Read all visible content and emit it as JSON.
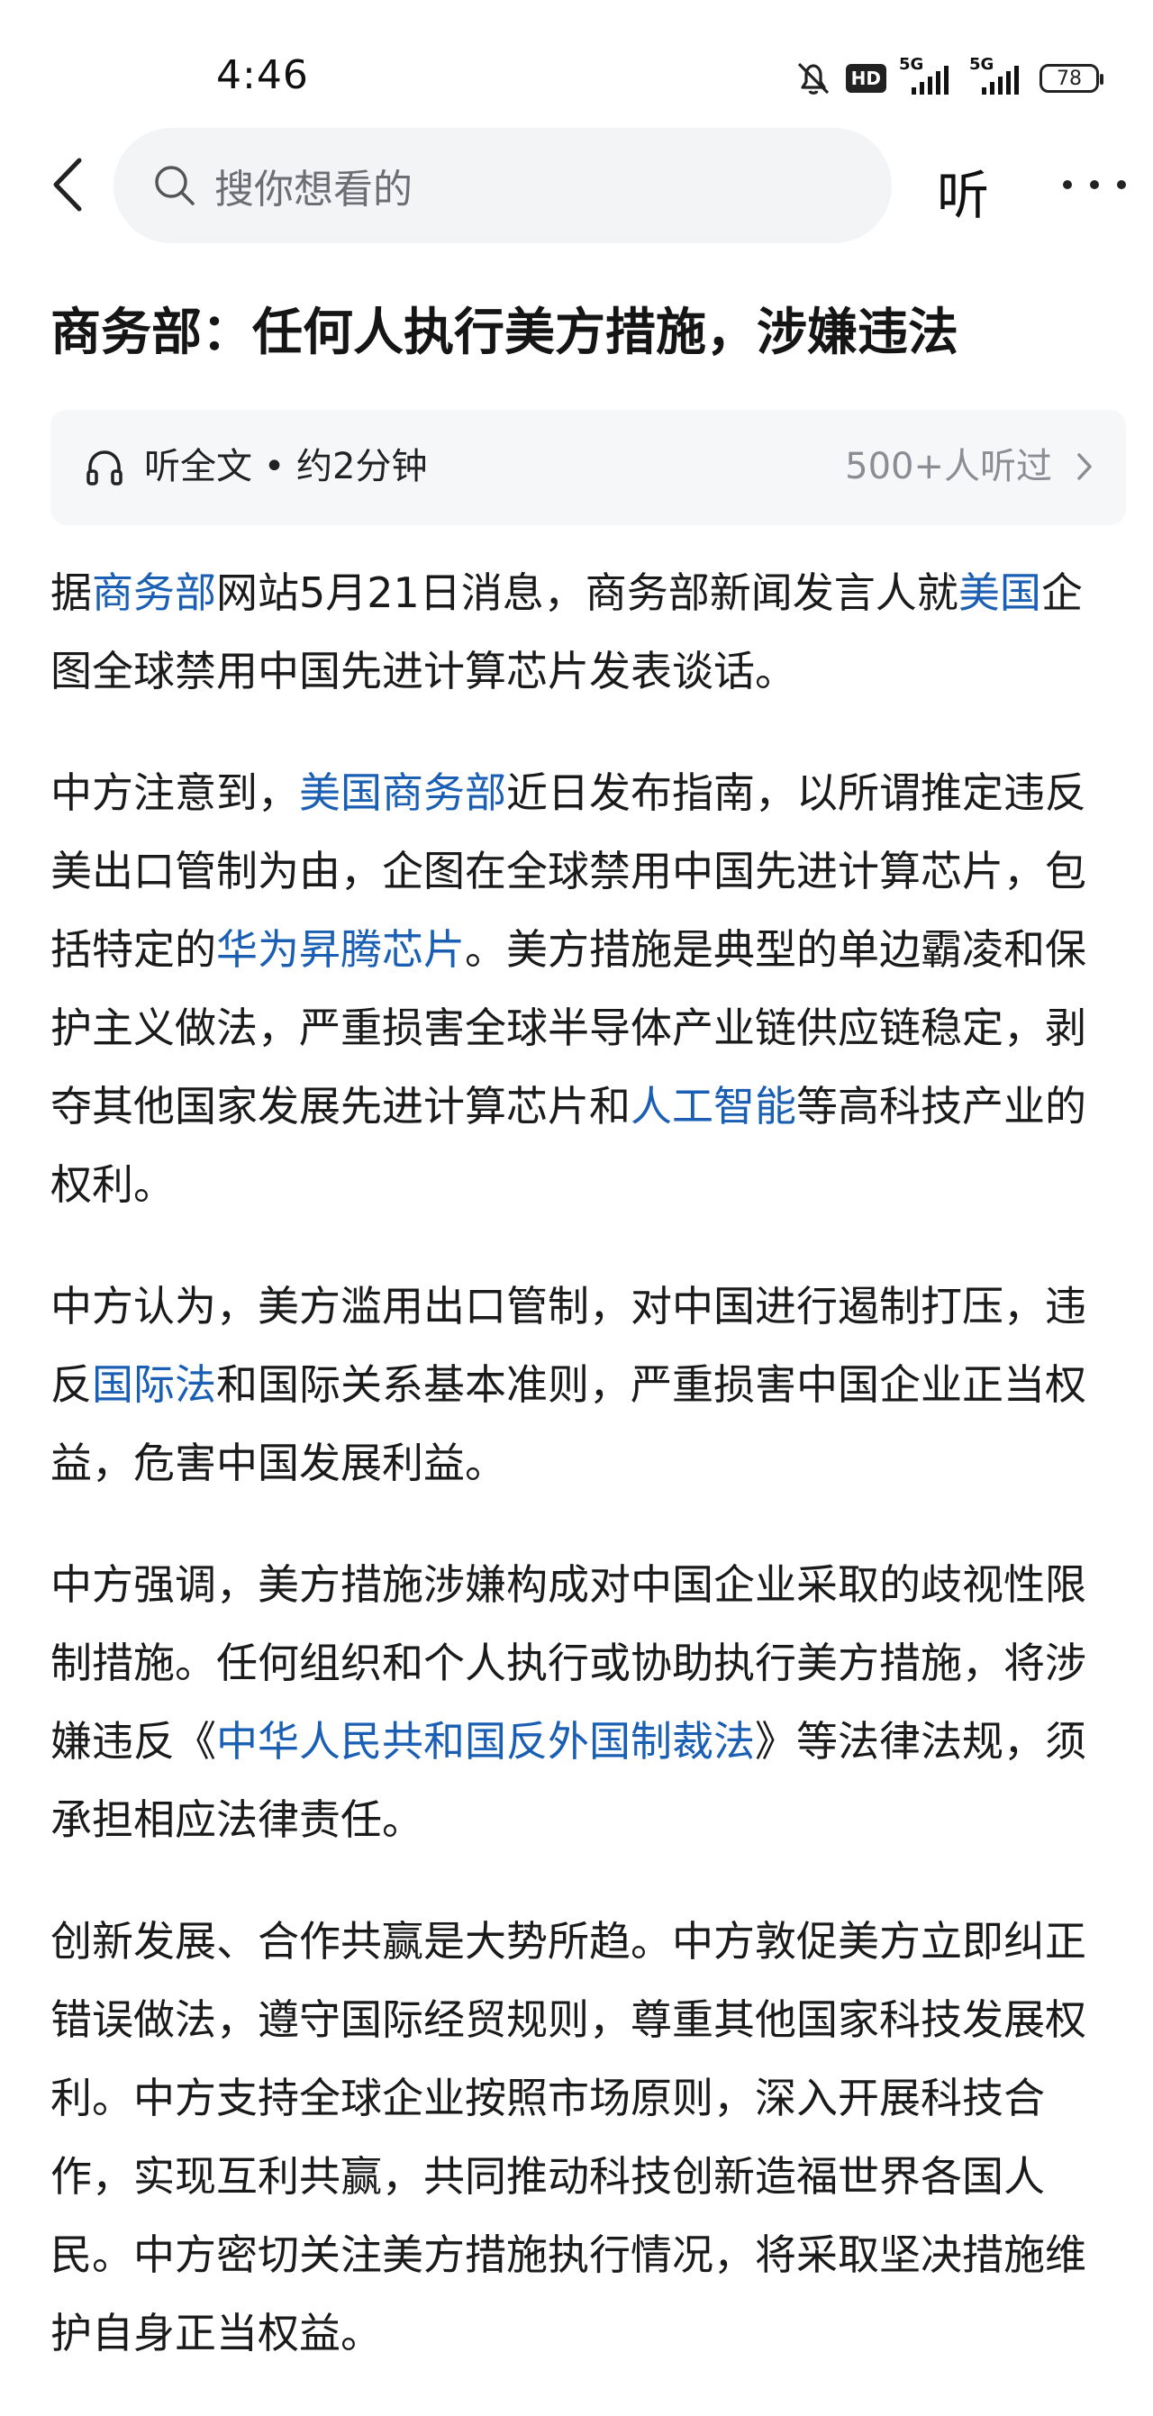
{
  "status_bar": {
    "time": "4:46",
    "hd_label": "HD",
    "sim1_label": "5G",
    "sim2_label": "5G",
    "battery": "78"
  },
  "header": {
    "search_placeholder": "搜你想看的",
    "listen_label": "听"
  },
  "article": {
    "title": "商务部：任何人执行美方措施，涉嫌违法",
    "audio": {
      "label": "听全文 • 约2分钟",
      "count": "500+人听过"
    },
    "paragraphs": [
      [
        {
          "text": "据"
        },
        {
          "text": "商务部",
          "link": true
        },
        {
          "text": "网站5月21日消息，商务部新闻发言人就"
        },
        {
          "text": "美国",
          "link": true
        },
        {
          "text": "企图全球禁用中国先进计算芯片发表谈话。"
        }
      ],
      [
        {
          "text": "中方注意到，"
        },
        {
          "text": "美国商务部",
          "link": true
        },
        {
          "text": "近日发布指南，以所谓推定违反美出口管制为由，企图在全球禁用中国先进计算芯片，包括特定的"
        },
        {
          "text": "华为昇腾芯片",
          "link": true
        },
        {
          "text": "。美方措施是典型的单边霸凌和保护主义做法，严重损害全球半导体产业链供应链稳定，剥夺其他国家发展先进计算芯片和"
        },
        {
          "text": "人工智能",
          "link": true
        },
        {
          "text": "等高科技产业的权利。"
        }
      ],
      [
        {
          "text": "中方认为，美方滥用出口管制，对中国进行遏制打压，违反"
        },
        {
          "text": "国际法",
          "link": true
        },
        {
          "text": "和国际关系基本准则，严重损害中国企业正当权益，危害中国发展利益。"
        }
      ],
      [
        {
          "text": "中方强调，美方措施涉嫌构成对中国企业采取的歧视性限制措施。任何组织和个人执行或协助执行美方措施，将涉嫌违反《"
        },
        {
          "text": "中华人民共和国反外国制裁法",
          "link": true
        },
        {
          "text": "》等法律法规，须承担相应法律责任。"
        }
      ],
      [
        {
          "text": "创新发展、合作共赢是大势所趋。中方敦促美方立即纠正错误做法，遵守国际经贸规则，尊重其他国家科技发展权利。中方支持全球企业按照市场原则，深入开展科技合作，实现互利共赢，共同推动科技创新造福世界各国人民。中方密切关注美方措施执行情况，将采取坚决措施维护自身正当权益。"
        }
      ]
    ]
  },
  "colors": {
    "link": "#1a5fb4",
    "text": "#1a1a1a",
    "muted": "#8a8d93",
    "search_bg": "#f3f4f6",
    "audio_bg": "#f6f7f9"
  },
  "icons": [
    "back-arrow-icon",
    "search-icon",
    "headphones-icon",
    "chevron-right-icon",
    "more-dots-icon",
    "bell-off-icon",
    "battery-icon",
    "signal-icon"
  ]
}
